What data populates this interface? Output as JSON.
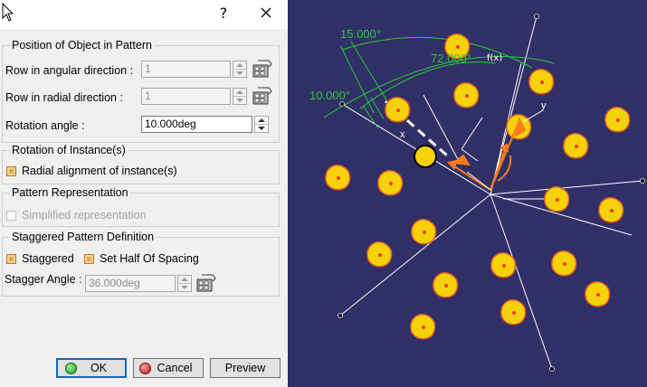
{
  "dialog": {
    "help_label": "?",
    "groups": {
      "position": {
        "title": "Position of Object in Pattern",
        "row_angular_label": "Row in angular direction :",
        "row_angular_value": "1",
        "row_radial_label": "Row in radial direction :",
        "row_radial_value": "1",
        "rotation_label": "Rotation angle :",
        "rotation_value": "10.000deg"
      },
      "rotation_instance": {
        "title": "Rotation of Instance(s)",
        "radial_alignment_label": "Radial alignment of instance(s)",
        "radial_alignment_checked": true
      },
      "representation": {
        "title": "Pattern Representation",
        "simplified_label": "Simplified representation",
        "simplified_checked": false
      },
      "staggered": {
        "title": "Staggered Pattern Definition",
        "staggered_label": "Staggered",
        "staggered_checked": true,
        "half_spacing_label": "Set Half Of Spacing",
        "half_spacing_checked": true,
        "stagger_angle_label": "Stagger Angle :",
        "stagger_angle_value": "36.000deg"
      }
    },
    "buttons": {
      "ok": "OK",
      "cancel": "Cancel",
      "preview": "Preview"
    }
  },
  "viewport": {
    "dimensions": {
      "d1": "15.000°",
      "d2": "72.000°",
      "d3": "10.000°"
    },
    "formula_marker": "f(x)",
    "axes": {
      "x": "x",
      "y": "y"
    },
    "colors": {
      "background": "#302f66",
      "instance_fill": "#f5d20a",
      "instance_outline": "#e0572a",
      "dimension": "#2fc93d",
      "axis": "#ff7a1a"
    }
  }
}
